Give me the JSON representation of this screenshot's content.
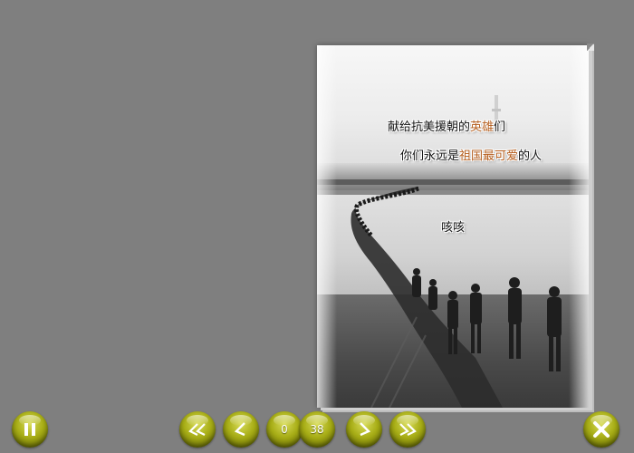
{
  "book": {
    "caption_line1_pre": "献给抗美援朝的",
    "caption_line1_hl": "英雄",
    "caption_line1_post": "们",
    "caption_line2_pre": "你们永远是",
    "caption_line2_hl": "祖国最可爱",
    "caption_line2_post": "的人",
    "caption_line3": "咳咳"
  },
  "toolbar": {
    "pause_icon": "pause-icon",
    "first_icon": "double-chevron-left-icon",
    "prev_icon": "chevron-left-icon",
    "current_page": "0",
    "total_pages": "38",
    "next_icon": "chevron-right-icon",
    "last_icon": "double-chevron-right-icon",
    "close_icon": "close-icon"
  },
  "colors": {
    "background": "#7f7f7f",
    "button": "#a7ad16",
    "highlight_text": "#b55d1c"
  }
}
